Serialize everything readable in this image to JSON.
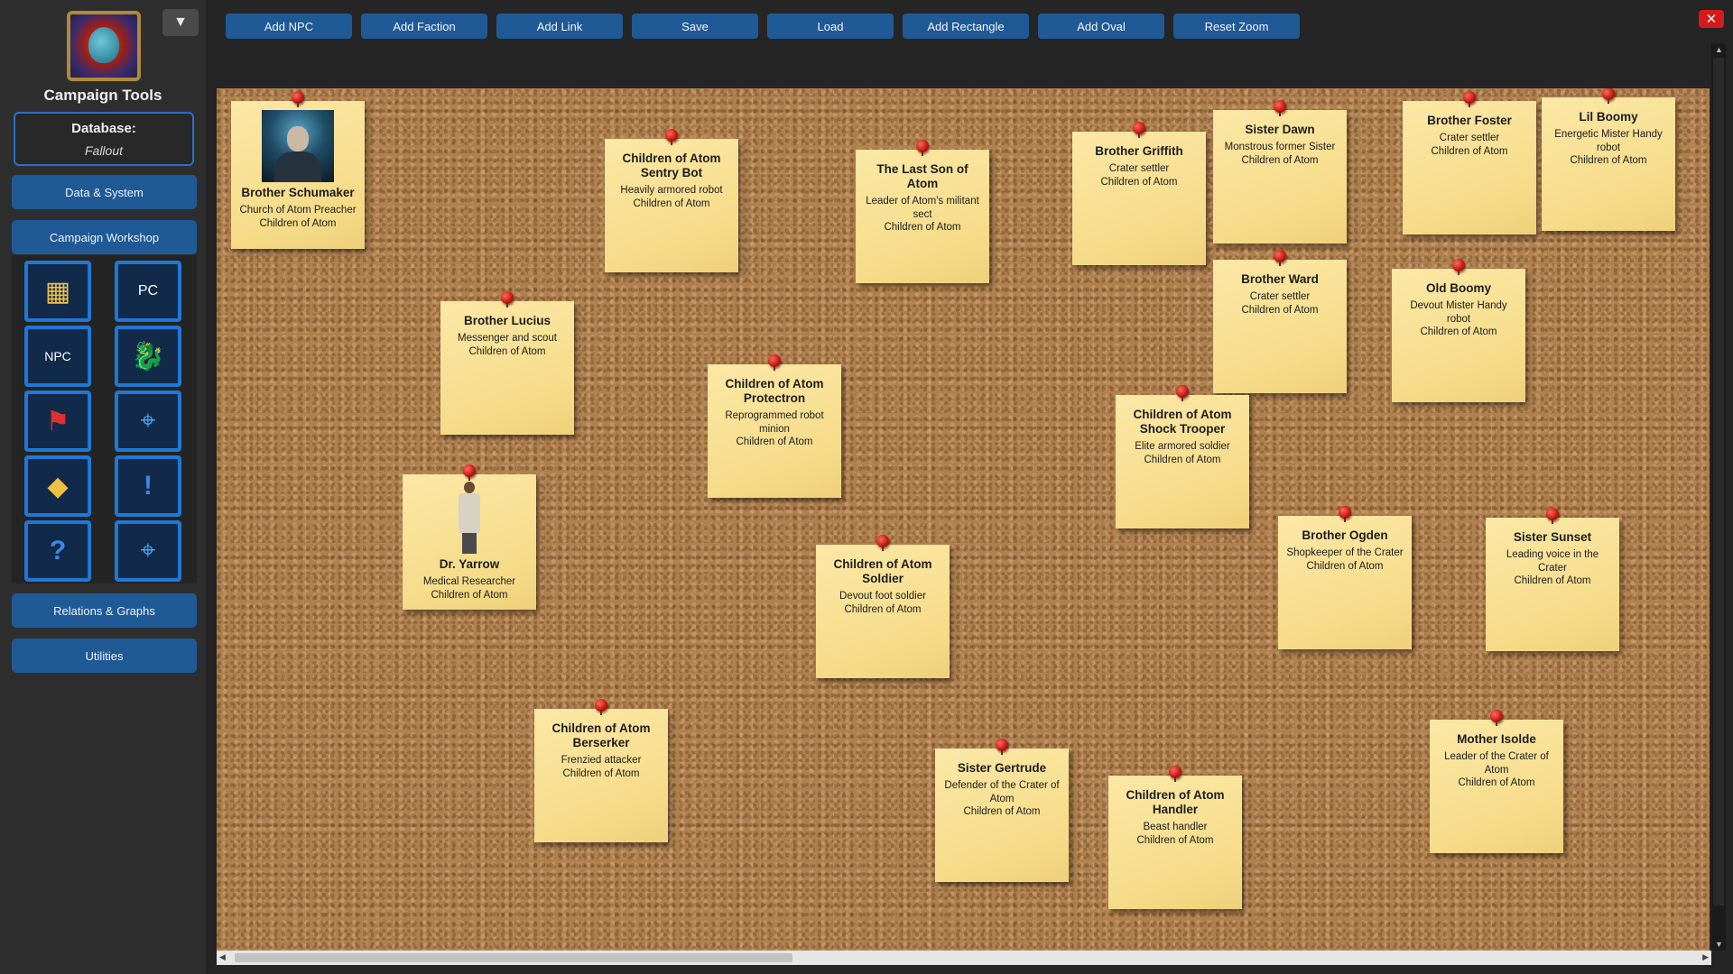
{
  "sidebar": {
    "app_title": "Campaign Tools",
    "menu_toggle": "▼",
    "database_label": "Database:",
    "database_name": "Fallout",
    "buttons": {
      "data_system": "Data & System",
      "campaign_workshop": "Campaign Workshop",
      "relations_graphs": "Relations & Graphs",
      "utilities": "Utilities"
    },
    "workshop_icons": [
      {
        "name": "map-scroll-icon",
        "glyph": "▦"
      },
      {
        "name": "pc-icon",
        "glyph": "PC"
      },
      {
        "name": "npc-icon",
        "glyph": "NPC"
      },
      {
        "name": "dragon-icon",
        "glyph": "🐉"
      },
      {
        "name": "flag-icon",
        "glyph": "⚑"
      },
      {
        "name": "map-pin-icon",
        "glyph": "⌖"
      },
      {
        "name": "treasure-icon",
        "glyph": "◆"
      },
      {
        "name": "quest-exclamation-icon",
        "glyph": "!"
      },
      {
        "name": "quest-question-icon",
        "glyph": "?"
      },
      {
        "name": "world-map-icon",
        "glyph": "⌖"
      }
    ]
  },
  "toolbar": {
    "add_npc": "Add NPC",
    "add_faction": "Add Faction",
    "add_link": "Add Link",
    "save": "Save",
    "load": "Load",
    "add_rectangle": "Add Rectangle",
    "add_oval": "Add Oval",
    "reset_zoom": "Reset Zoom",
    "close": "✕"
  },
  "notes": [
    {
      "title": "Brother Schumaker",
      "desc": "Church of Atom Preacher",
      "faction": "Children of Atom"
    },
    {
      "title": "Children of Atom Sentry Bot",
      "desc": "Heavily armored robot",
      "faction": "Children of Atom"
    },
    {
      "title": "The Last Son of Atom",
      "desc": "Leader of Atom's militant sect",
      "faction": "Children of Atom"
    },
    {
      "title": "Brother Griffith",
      "desc": "Crater settler",
      "faction": "Children of Atom"
    },
    {
      "title": "Sister Dawn",
      "desc": "Monstrous former Sister",
      "faction": "Children of Atom"
    },
    {
      "title": "Brother Foster",
      "desc": "Crater settler",
      "faction": "Children of Atom"
    },
    {
      "title": "Lil Boomy",
      "desc": "Energetic Mister Handy robot",
      "faction": "Children of Atom"
    },
    {
      "title": "Brother Ward",
      "desc": "Crater settler",
      "faction": "Children of Atom"
    },
    {
      "title": "Old Boomy",
      "desc": "Devout Mister Handy robot",
      "faction": "Children of Atom"
    },
    {
      "title": "Brother Lucius",
      "desc": "Messenger and scout",
      "faction": "Children of Atom"
    },
    {
      "title": "Children of Atom Protectron",
      "desc": "Reprogrammed robot minion",
      "faction": "Children of Atom"
    },
    {
      "title": "Children of Atom Shock Trooper",
      "desc": "Elite armored soldier",
      "faction": "Children of Atom"
    },
    {
      "title": "Dr. Yarrow",
      "desc": "Medical Researcher",
      "faction": "Children of Atom"
    },
    {
      "title": "Children of Atom Soldier",
      "desc": "Devout foot soldier",
      "faction": "Children of Atom"
    },
    {
      "title": "Brother Ogden",
      "desc": "Shopkeeper of the Crater",
      "faction": "Children of Atom"
    },
    {
      "title": "Sister Sunset",
      "desc": "Leading voice in the Crater",
      "faction": "Children of Atom"
    },
    {
      "title": "Children of Atom Berserker",
      "desc": "Frenzied attacker",
      "faction": "Children of Atom"
    },
    {
      "title": "Sister Gertrude",
      "desc": "Defender of the Crater of Atom",
      "faction": "Children of Atom"
    },
    {
      "title": "Children of Atom Handler",
      "desc": "Beast handler",
      "faction": "Children of Atom"
    },
    {
      "title": "Mother Isolde",
      "desc": "Leader of the Crater of Atom",
      "faction": "Children of Atom"
    }
  ],
  "colors": {
    "button_blue": "#1f5a96",
    "accent_border": "#2d6fc4",
    "note_yellow": "#f6dc8a",
    "pin_red": "#c0150f",
    "close_red": "#d41a1a",
    "cork": "#b0804f"
  }
}
